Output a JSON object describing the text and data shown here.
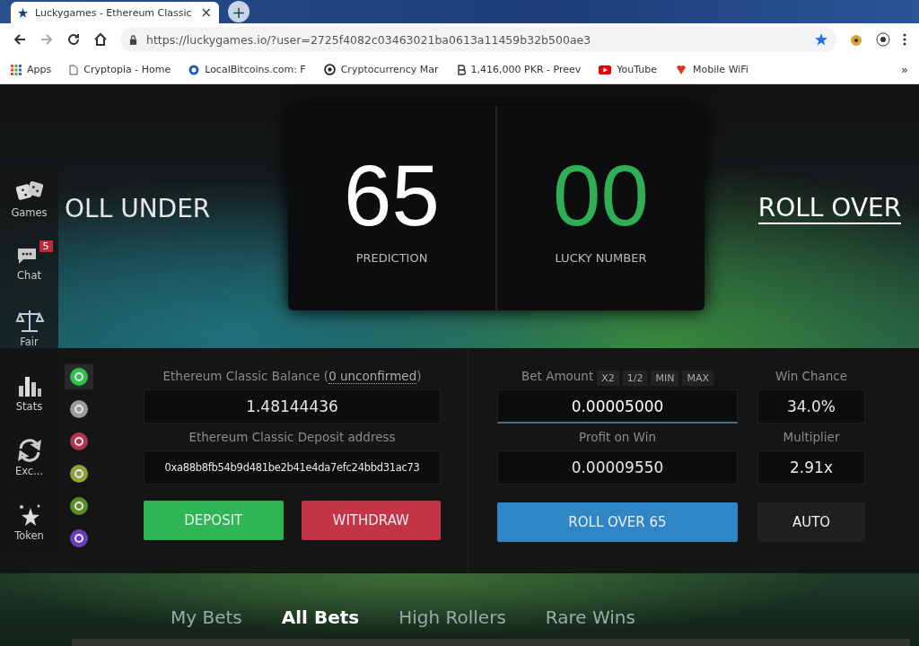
{
  "browser": {
    "tab": {
      "title": "Luckygames - Ethereum Classic",
      "close": "×"
    },
    "new_tab": "+",
    "url": "https://luckygames.io/?user=2725f4082c03463021ba0613a11459b32b500ae3",
    "bookmarks": [
      {
        "kind": "apps",
        "label": "Apps"
      },
      {
        "kind": "page",
        "label": "Cryptopia - Home"
      },
      {
        "kind": "circle",
        "label": "LocalBitcoins.com: F"
      },
      {
        "kind": "cm",
        "label": "Cryptocurrency Mar"
      },
      {
        "kind": "b",
        "label": "1,416,000 PKR - Preev"
      },
      {
        "kind": "youtube",
        "label": "YouTube"
      },
      {
        "kind": "huawei",
        "label": "Mobile WiFi"
      }
    ],
    "overflow": "»"
  },
  "hero": {
    "roll_under": "OLL UNDER",
    "prediction": {
      "value": "65",
      "label": "PREDICTION"
    },
    "lucky": {
      "value": "00",
      "label": "LUCKY NUMBER"
    },
    "roll_over": "ROLL OVER"
  },
  "sidebar": [
    {
      "kind": "dice",
      "label": "Games"
    },
    {
      "kind": "chat",
      "label": "Chat",
      "badge": "5"
    },
    {
      "kind": "scale",
      "label": "Fair"
    },
    {
      "kind": "stats",
      "label": "Stats"
    },
    {
      "kind": "exchange",
      "label": "Exc..."
    },
    {
      "kind": "stars",
      "label": "Token"
    }
  ],
  "coins": [
    {
      "color": "#2fbf4a",
      "selected": true
    },
    {
      "color": "#9a9a9a",
      "selected": false
    },
    {
      "color": "#b0344f",
      "selected": false
    },
    {
      "color": "#8aa43a",
      "selected": false
    },
    {
      "color": "#5f8a2a",
      "selected": false
    },
    {
      "color": "#6b3fb5",
      "selected": false
    }
  ],
  "wallet": {
    "balance_label": "Ethereum Classic Balance (",
    "unconfirmed": "0 unconfirmed",
    "balance_suffix": ")",
    "balance": "1.48144436",
    "address_label": "Ethereum Classic Deposit address",
    "address": "0xa88b8fb54b9d481be2b41e4da7efc24bbd31ac73",
    "deposit": "DEPOSIT",
    "withdraw": "WITHDRAW"
  },
  "bet": {
    "label": "Bet Amount",
    "quick": [
      "X2",
      "1/2",
      "MIN",
      "MAX"
    ],
    "amount": "0.00005000",
    "focused": true,
    "win_chance_label": "Win Chance",
    "win_chance": "34.0%",
    "profit_label": "Profit on Win",
    "profit": "0.00009550",
    "multiplier_label": "Multiplier",
    "multiplier": "2.91x",
    "roll": "ROLL OVER 65",
    "auto": "AUTO"
  },
  "tabs": [
    {
      "label": "My Bets",
      "selected": false
    },
    {
      "label": "All Bets",
      "selected": true
    },
    {
      "label": "High Rollers",
      "selected": false
    },
    {
      "label": "Rare Wins",
      "selected": false
    }
  ]
}
